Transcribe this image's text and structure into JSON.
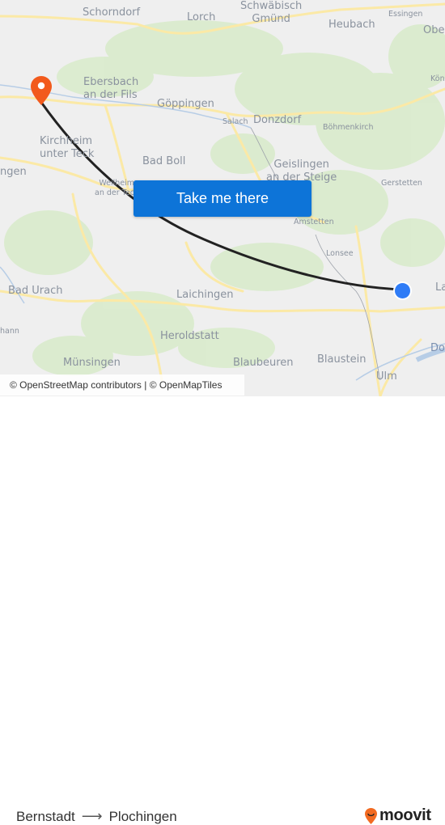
{
  "map": {
    "places": [
      {
        "name": "Schorndorf",
        "size": "lg"
      },
      {
        "name": "Lorch",
        "size": "lg"
      },
      {
        "name": "Schwäbisch\nGmünd",
        "size": "lg"
      },
      {
        "name": "Heubach",
        "size": "lg"
      },
      {
        "name": "Essingen",
        "size": "sm"
      },
      {
        "name": "Ober",
        "size": "lg"
      },
      {
        "name": "Kön",
        "size": "sm"
      },
      {
        "name": "Ebersbach\nan der Fils",
        "size": "lg"
      },
      {
        "name": "Göppingen",
        "size": "lg"
      },
      {
        "name": "Salach",
        "size": "sm"
      },
      {
        "name": "Donzdorf",
        "size": "lg"
      },
      {
        "name": "Böhmenkirch",
        "size": "sm"
      },
      {
        "name": "Kirchheim\nunter Teck",
        "size": "lg"
      },
      {
        "name": "ngen",
        "size": "lg"
      },
      {
        "name": "Bad Boll",
        "size": "lg"
      },
      {
        "name": "Geislingen\nan der Steige",
        "size": "lg"
      },
      {
        "name": "Weilheim\nan der Teck",
        "size": "sm"
      },
      {
        "name": "Gerstetten",
        "size": "sm"
      },
      {
        "name": "Amstetten",
        "size": "sm"
      },
      {
        "name": "Lonsee",
        "size": "sm"
      },
      {
        "name": "Bad Urach",
        "size": "lg"
      },
      {
        "name": "Laichingen",
        "size": "lg"
      },
      {
        "name": "La",
        "size": "lg"
      },
      {
        "name": "hann",
        "size": "sm"
      },
      {
        "name": "Heroldstatt",
        "size": "lg"
      },
      {
        "name": "Münsingen",
        "size": "lg"
      },
      {
        "name": "Blaubeuren",
        "size": "lg"
      },
      {
        "name": "Blaustein",
        "size": "lg"
      },
      {
        "name": "Ulm",
        "size": "lg"
      },
      {
        "name": "Do",
        "size": "lg"
      }
    ],
    "origin_marker": {
      "icon": "current-location-dot",
      "color": "#2f7cf6"
    },
    "destination_marker": {
      "icon": "map-pin",
      "color": "#f25a1c"
    },
    "route_color": "#222222"
  },
  "cta": {
    "label": "Take me there",
    "color": "#0d74d8"
  },
  "attribution": "© OpenStreetMap contributors | © OpenMapTiles",
  "route": {
    "from": "Bernstadt",
    "arrow": "⟶",
    "to": "Plochingen"
  },
  "brand": {
    "name": "moovit",
    "color": "#f26a21"
  }
}
